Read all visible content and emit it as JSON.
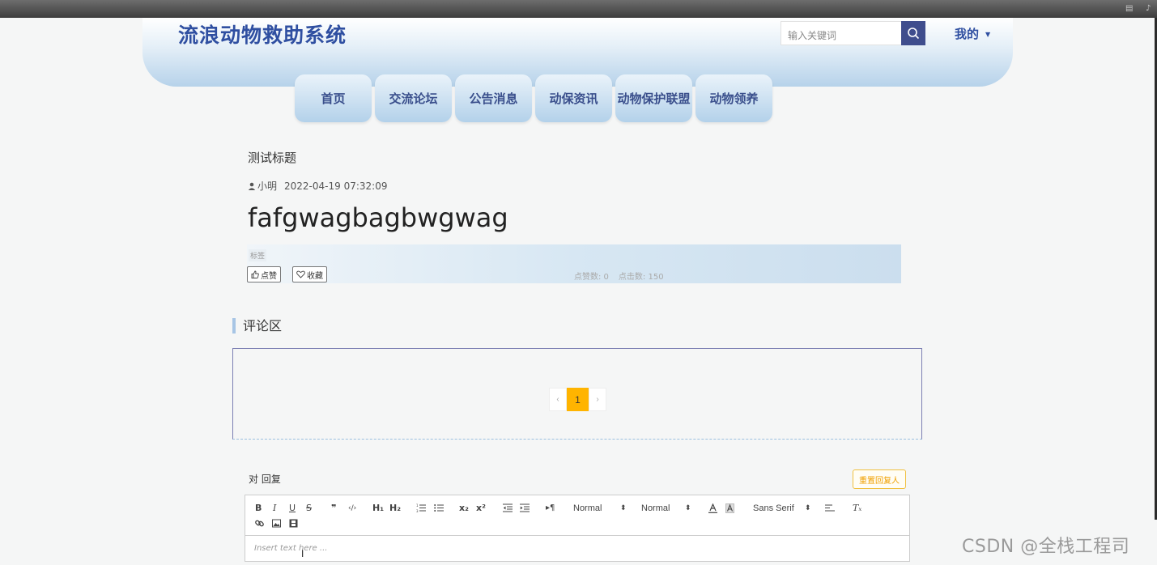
{
  "header": {
    "site_title": "流浪动物救助系统",
    "search_placeholder": "输入关键词",
    "mine_label": "我的"
  },
  "nav": [
    {
      "label": "首页"
    },
    {
      "label": "交流论坛"
    },
    {
      "label": "公告消息"
    },
    {
      "label": "动保资讯"
    },
    {
      "label": "动物保护联盟"
    },
    {
      "label": "动物领养"
    }
  ],
  "post": {
    "title": "测试标题",
    "author": "小明",
    "date": "2022-04-19 07:32:09",
    "body": "fafgwagbagbwgwag",
    "tag_label": "标签",
    "like_label": "点赞",
    "favorite_label": "收藏",
    "like_count_text": "点赞数: 0",
    "click_count_text": "点击数: 150"
  },
  "comments": {
    "section_title": "评论区",
    "pagination": {
      "prev": "‹",
      "current": "1",
      "next": "›"
    }
  },
  "reply": {
    "label": "对 回复",
    "reset_button": "重置回复人"
  },
  "editor": {
    "placeholder": "Insert text here ...",
    "header_select": "Normal",
    "size_select": "Normal",
    "font_select": "Sans Serif",
    "tools": {
      "bold": "B",
      "italic": "I",
      "underline": "U",
      "strike": "S",
      "blockquote": "❞",
      "code": "‹/›",
      "h1": "H₁",
      "h2": "H₂",
      "sub": "x₂",
      "sup": "x²",
      "direction": "▸¶",
      "clean": "Tₓ"
    }
  },
  "watermark": "CSDN @全栈工程司",
  "colors": {
    "brand_blue": "#2f4fa1",
    "search_button": "#3f4d8d",
    "page_active": "#ffb400",
    "reset_button": "#f0a000"
  }
}
